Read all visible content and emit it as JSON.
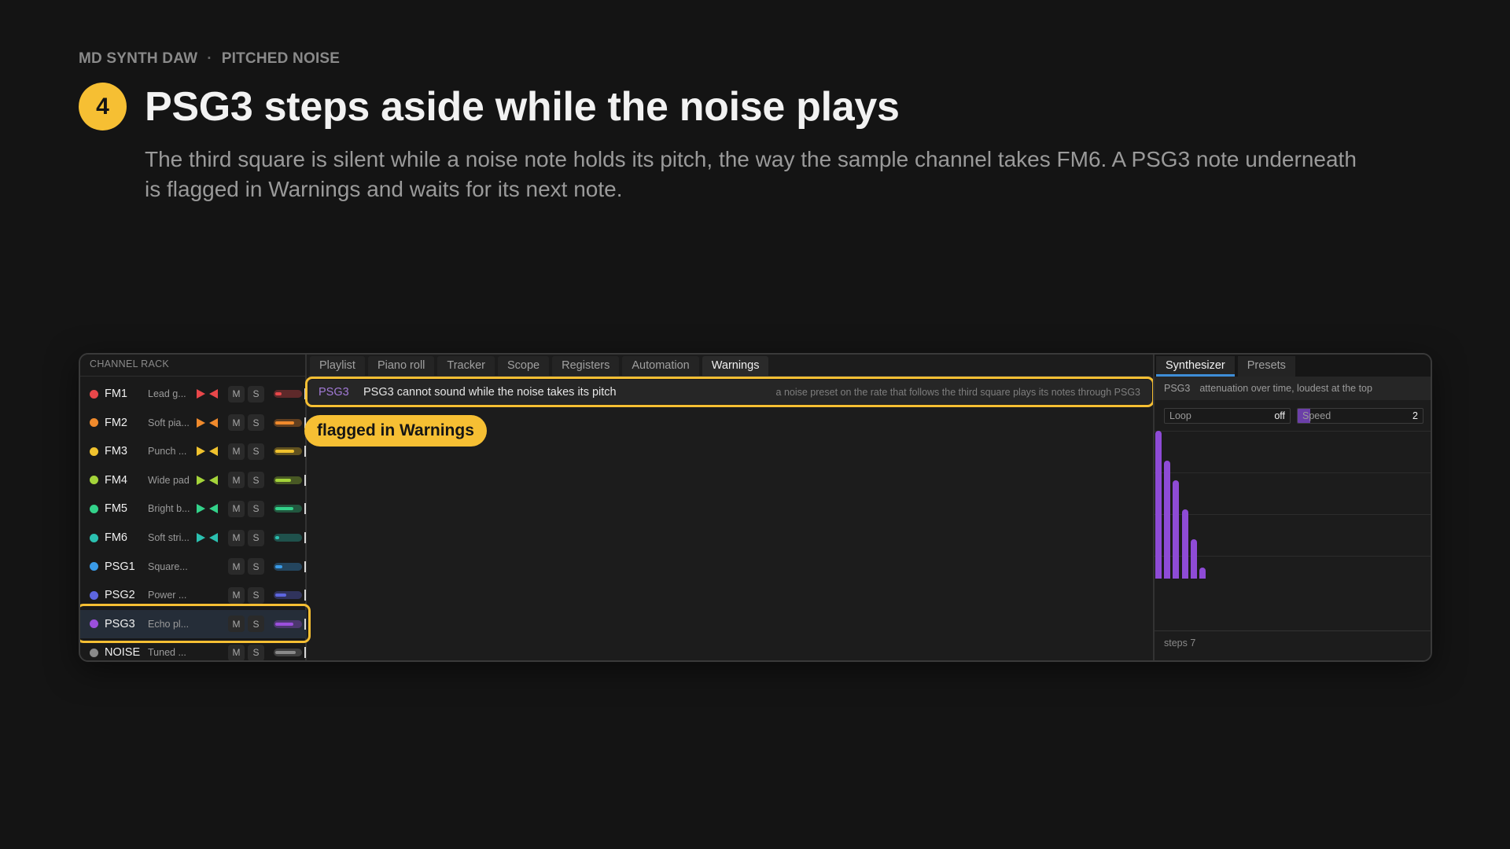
{
  "header": {
    "app": "MD SYNTH DAW",
    "separator": "·",
    "section": "PITCHED NOISE",
    "step": "4",
    "title": "PSG3 steps aside while the noise plays",
    "subtitle": "The third square is silent while a noise note holds its pitch, the way the sample channel takes FM6. A PSG3 note underneath is flagged in Warnings and waits for its next note."
  },
  "rack": {
    "header": "CHANNEL RACK",
    "mute_label": "M",
    "solo_label": "S",
    "channels": [
      {
        "name": "FM1",
        "preset": "Lead g...",
        "color": "#e8474a",
        "pan": true,
        "volume": 0.25
      },
      {
        "name": "FM2",
        "preset": "Soft pia...",
        "color": "#f08a2c",
        "pan": true,
        "volume": 0.8
      },
      {
        "name": "FM3",
        "preset": "Punch ...",
        "color": "#f0c22e",
        "pan": true,
        "volume": 0.8
      },
      {
        "name": "FM4",
        "preset": "Wide pad",
        "color": "#a4d43a",
        "pan": true,
        "volume": 0.65
      },
      {
        "name": "FM5",
        "preset": "Bright b...",
        "color": "#33d28a",
        "pan": true,
        "volume": 0.75
      },
      {
        "name": "FM6",
        "preset": "Soft stri...",
        "color": "#2bc0b0",
        "pan": true,
        "volume": 0.15
      },
      {
        "name": "PSG1",
        "preset": "Square...",
        "color": "#3a9be8",
        "pan": false,
        "volume": 0.3
      },
      {
        "name": "PSG2",
        "preset": "Power ...",
        "color": "#5d66e0",
        "pan": false,
        "volume": 0.45
      },
      {
        "name": "PSG3",
        "preset": "Echo pl...",
        "color": "#9b4fdc",
        "pan": false,
        "volume": 0.75
      },
      {
        "name": "NOISE",
        "preset": "Tuned ...",
        "color": "#8a8a8a",
        "pan": false,
        "volume": 0.85
      }
    ],
    "selected": "PSG3"
  },
  "tabs": [
    "Playlist",
    "Piano roll",
    "Tracker",
    "Scope",
    "Registers",
    "Automation",
    "Warnings"
  ],
  "active_tab": "Warnings",
  "warning": {
    "channel": "PSG3",
    "message": "PSG3 cannot sound while the noise takes its pitch",
    "detail": "a noise preset on the rate that follows the third square plays its notes through PSG3"
  },
  "callout": "flagged in Warnings",
  "synth": {
    "tabs": [
      "Synthesizer",
      "Presets"
    ],
    "active_tab": "Synthesizer",
    "channel": "PSG3",
    "envelope_label": "attenuation over time, loudest at the top",
    "loop_label": "Loop",
    "loop_value": "off",
    "speed_label": "Speed",
    "speed_value": "2",
    "speed_fill": 0.1,
    "envelope_levels": [
      15,
      12,
      10,
      7,
      4,
      1
    ],
    "envelope_max": 15,
    "footer": "steps 7"
  },
  "colors": {
    "accent": "#f6bf33",
    "warning_channel": "#a27ad6",
    "envelope": "#8e4bd6",
    "tab_underline": "#3e8ed8"
  }
}
